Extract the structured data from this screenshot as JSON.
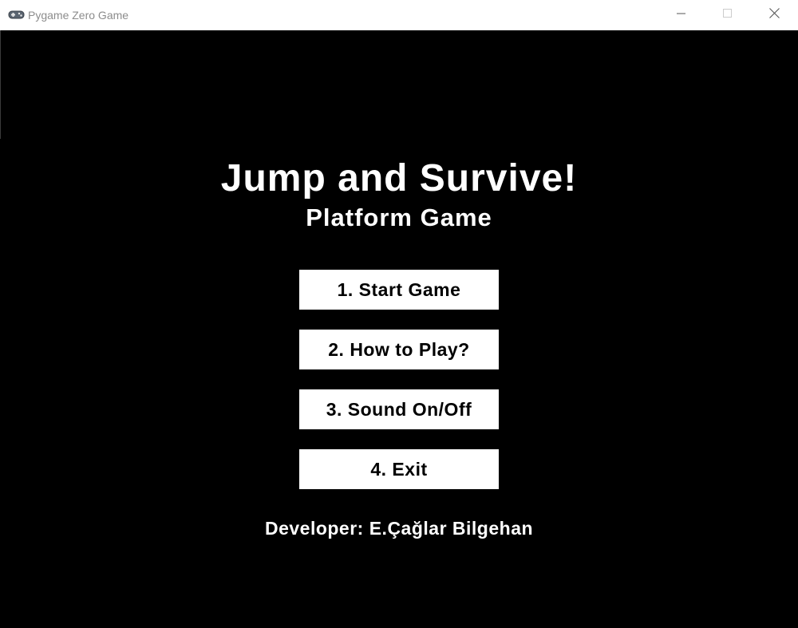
{
  "window": {
    "title": "Pygame Zero Game",
    "app_icon": "gamepad-icon",
    "controls": {
      "minimize": "minimize-icon",
      "maximize": "maximize-icon",
      "close": "close-icon"
    }
  },
  "game": {
    "title": "Jump and Survive!",
    "subtitle": "Platform Game",
    "menu": [
      {
        "label": "1. Start Game"
      },
      {
        "label": "2. How to Play?"
      },
      {
        "label": "3. Sound On/Off"
      },
      {
        "label": "4. Exit"
      }
    ],
    "developer": "Developer: E.Çağlar Bilgehan"
  },
  "colors": {
    "background": "#000000",
    "text": "#ffffff",
    "button_bg": "#ffffff",
    "button_text": "#000000"
  }
}
